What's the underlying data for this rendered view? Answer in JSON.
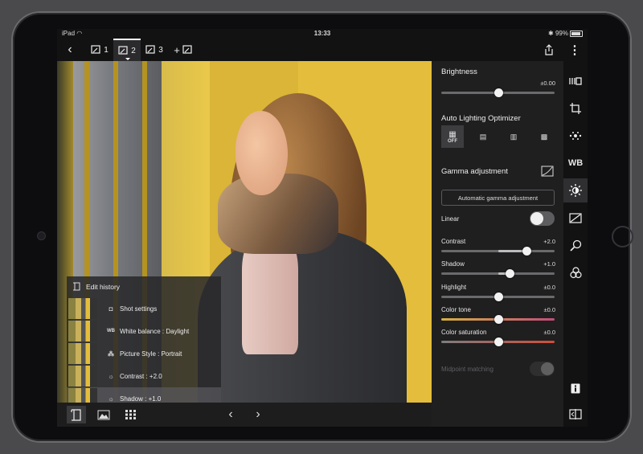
{
  "status_bar": {
    "device": "iPad",
    "time": "13:33",
    "battery": "99%"
  },
  "toolbar": {
    "tabs": [
      {
        "num": "1"
      },
      {
        "num": "2"
      },
      {
        "num": "3"
      }
    ],
    "add_tab_label": "+"
  },
  "edit_history": {
    "title": "Edit history",
    "items": [
      {
        "icon": "camera-icon",
        "label": "Shot settings"
      },
      {
        "icon": "wb-icon",
        "icon_text": "WB",
        "label": "White balance : Daylight"
      },
      {
        "icon": "picture-style-icon",
        "label": "Picture Style : Portrait"
      },
      {
        "icon": "sun-icon",
        "label": "Contrast : +2.0"
      },
      {
        "icon": "sun-icon",
        "label": "Shadow : +1.0"
      }
    ]
  },
  "panel": {
    "brightness": {
      "title": "Brightness",
      "value": "±0.00",
      "level": 0.5
    },
    "auto_lighting": {
      "title": "Auto Lighting Optimizer",
      "options": [
        "OFF"
      ]
    },
    "gamma": {
      "title": "Gamma adjustment",
      "button": "Automatic gamma adjustment"
    },
    "linear": {
      "label": "Linear"
    },
    "sliders": [
      {
        "label": "Contrast",
        "value": "+2.0",
        "level": 0.75
      },
      {
        "label": "Shadow",
        "value": "+1.0",
        "level": 0.6
      },
      {
        "label": "Highlight",
        "value": "±0.0",
        "level": 0.5
      },
      {
        "label": "Color tone",
        "value": "±0.0",
        "level": 0.5
      },
      {
        "label": "Color saturation",
        "value": "±0.0",
        "level": 0.5
      }
    ],
    "midpoint": {
      "label": "Midpoint matching"
    }
  },
  "side_tools": {
    "wb_label": "WB"
  },
  "colors": {
    "accent_tone": "#e0b23a",
    "tone_left": "#d8b040",
    "tone_right": "#c24c7a",
    "saturation_left": "#7d7d80",
    "saturation_right": "#d24d3a"
  }
}
